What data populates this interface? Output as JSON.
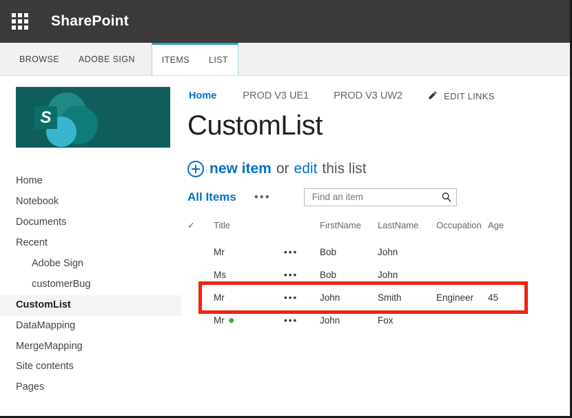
{
  "suite_bar": {
    "waffle_icon": "app-launcher-waffle-icon",
    "title": "SharePoint"
  },
  "ribbon": {
    "tabs": [
      {
        "label": "BROWSE",
        "selected": false
      },
      {
        "label": "ADOBE SIGN",
        "selected": false
      },
      {
        "label": "ITEMS",
        "selected": true
      },
      {
        "label": "LIST",
        "selected": true
      }
    ]
  },
  "site_logo": {
    "letter": "S",
    "background_color": "#105e5c"
  },
  "quick_launch": {
    "items": [
      {
        "label": "Home",
        "child": false,
        "selected": false
      },
      {
        "label": "Notebook",
        "child": false,
        "selected": false
      },
      {
        "label": "Documents",
        "child": false,
        "selected": false
      },
      {
        "label": "Recent",
        "child": false,
        "selected": false
      },
      {
        "label": "Adobe Sign",
        "child": true,
        "selected": false
      },
      {
        "label": "customerBug",
        "child": true,
        "selected": false
      },
      {
        "label": "CustomList",
        "child": false,
        "selected": true
      },
      {
        "label": "DataMapping",
        "child": false,
        "selected": false
      },
      {
        "label": "MergeMapping",
        "child": false,
        "selected": false
      },
      {
        "label": "Site contents",
        "child": false,
        "selected": false
      },
      {
        "label": "Pages",
        "child": false,
        "selected": false
      }
    ]
  },
  "top_nav": {
    "links": [
      {
        "label": "Home",
        "active": true
      },
      {
        "label": "PROD V3 UE1",
        "active": false
      },
      {
        "label": "PROD V3 UW2",
        "active": false
      }
    ],
    "edit_links_label": "EDIT LINKS",
    "edit_links_icon": "pencil-icon"
  },
  "page": {
    "title": "CustomList"
  },
  "command_line": {
    "plus_icon": "plus-circle-icon",
    "new_item_label": "new item",
    "or_label": "or",
    "edit_label": "edit",
    "this_list_label": "this list"
  },
  "view_bar": {
    "view_name": "All Items",
    "ellipsis": "•••",
    "search": {
      "value": "",
      "placeholder": "Find an item",
      "icon": "search-icon"
    }
  },
  "list": {
    "columns": [
      {
        "key": "check",
        "label": "✓"
      },
      {
        "key": "title",
        "label": "Title"
      },
      {
        "key": "ellipsis",
        "label": ""
      },
      {
        "key": "firstname",
        "label": "FirstName"
      },
      {
        "key": "lastname",
        "label": "LastName"
      },
      {
        "key": "occupation",
        "label": "Occupation"
      },
      {
        "key": "age",
        "label": "Age"
      }
    ],
    "rows": [
      {
        "title": "Mr",
        "is_new": false,
        "ellipsis": "•••",
        "firstname": "Bob",
        "lastname": "John",
        "occupation": "",
        "age": "",
        "highlighted": false
      },
      {
        "title": "Ms",
        "is_new": false,
        "ellipsis": "•••",
        "firstname": "Bob",
        "lastname": "John",
        "occupation": "",
        "age": "",
        "highlighted": false
      },
      {
        "title": "Mr",
        "is_new": false,
        "ellipsis": "•••",
        "firstname": "John",
        "lastname": "Smith",
        "occupation": "Engineer",
        "age": "45",
        "highlighted": true
      },
      {
        "title": "Mr",
        "is_new": true,
        "new_badge": "✸",
        "ellipsis": "•••",
        "firstname": "John",
        "lastname": "Fox",
        "occupation": "",
        "age": "",
        "highlighted": false
      }
    ]
  },
  "annotation": {
    "highlight_color": "#f02311",
    "target_row_index": 2
  }
}
